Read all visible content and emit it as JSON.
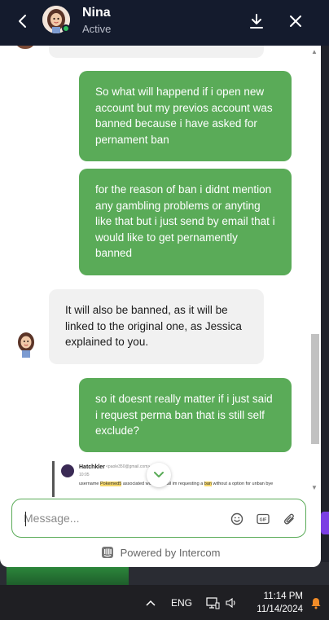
{
  "header": {
    "agent_name": "Nina",
    "agent_status": "Active",
    "icons": [
      "chevron-left-icon",
      "download-icon",
      "close-icon"
    ]
  },
  "messages": [
    {
      "from": "user",
      "text": "So what will happend if i open new account but my previos account was banned because i have asked for pernament ban"
    },
    {
      "from": "user",
      "text": "for the reason of ban i didnt mention any gambling problems or anyting like that but i just send by email that i would like to get pernamently banned"
    },
    {
      "from": "agent",
      "text": "It will also be banned, as it will be linked to the original one, as Jessica explained to you."
    },
    {
      "from": "user",
      "text": "so it doesnt really matter if i just said i request perma ban that is still self exclude?"
    }
  ],
  "attachment_preview": {
    "sender_name": "Hatchkler",
    "sender_email": "<paole350@gmail.com>",
    "time": "10:05",
    "line_start": "username ",
    "line_highlight_1": "Pokemed5",
    "line_mid": " associated with this mail im requesting a ",
    "line_highlight_2": "ban",
    "line_end": " without a option for unban bye"
  },
  "composer": {
    "placeholder": "Message...",
    "icons": [
      "emoji-icon",
      "gif-icon",
      "attachment-icon"
    ]
  },
  "footer": {
    "powered_by": "Powered by Intercom"
  },
  "taskbar": {
    "language": "ENG",
    "time": "11:14 PM",
    "date": "11/14/2024"
  },
  "colors": {
    "header_bg": "#141b2d",
    "user_bubble": "#5aab58",
    "agent_bubble": "#f1f1f1",
    "accent_green": "#5aab58"
  }
}
